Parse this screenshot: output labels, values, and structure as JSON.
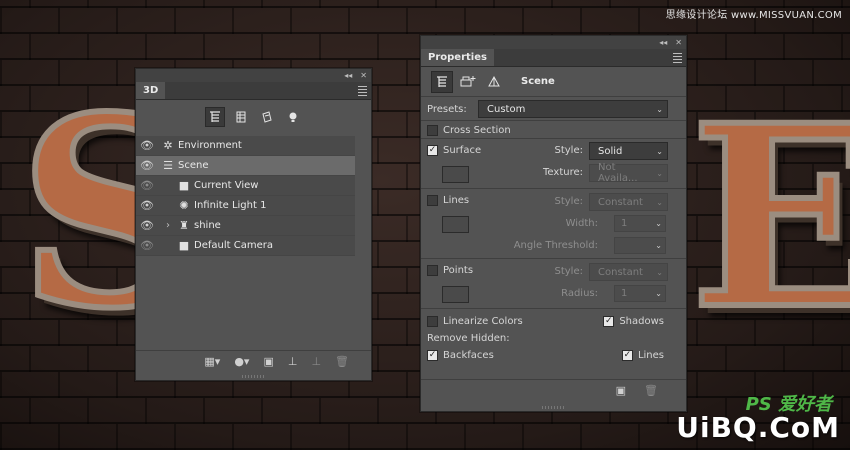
{
  "background": {
    "letter_left": "S",
    "letter_right": "E",
    "watermark_top": "思缘设计论坛 www.MISSVUAN.COM",
    "watermark_ps": "PS 爱好者",
    "watermark_brand": "UiBQ.CoM"
  },
  "panel_3d": {
    "tab": "3D",
    "mode_icons": [
      "scene-filter-icon",
      "mesh-filter-icon",
      "material-filter-icon",
      "light-filter-icon"
    ],
    "layers": [
      {
        "name": "Environment",
        "icon": "environment-icon",
        "visible": true,
        "indent": 0,
        "selected": false
      },
      {
        "name": "Scene",
        "icon": "scene-icon",
        "visible": true,
        "indent": 0,
        "selected": true
      },
      {
        "name": "Current View",
        "icon": "camera-icon",
        "visible": true,
        "indent": 1,
        "selected": false
      },
      {
        "name": "Infinite Light 1",
        "icon": "light-icon",
        "visible": true,
        "indent": 1,
        "selected": false
      },
      {
        "name": "shine",
        "icon": "mesh-icon",
        "visible": true,
        "indent": 1,
        "selected": false
      },
      {
        "name": "Default Camera",
        "icon": "camera-icon",
        "visible": true,
        "indent": 1,
        "selected": false
      }
    ]
  },
  "properties": {
    "tab": "Properties",
    "title": "Scene",
    "presets_label": "Presets:",
    "presets_value": "Custom",
    "cross_section": {
      "label": "Cross Section",
      "checked": false
    },
    "surface": {
      "label": "Surface",
      "checked": true,
      "style_label": "Style:",
      "style_value": "Solid",
      "texture_label": "Texture:",
      "texture_value": "Not Availa..."
    },
    "lines": {
      "label": "Lines",
      "checked": false,
      "style_label": "Style:",
      "style_value": "Constant",
      "width_label": "Width:",
      "width_value": "1",
      "angle_label": "Angle Threshold:",
      "angle_value": ""
    },
    "points": {
      "label": "Points",
      "checked": false,
      "style_label": "Style:",
      "style_value": "Constant",
      "radius_label": "Radius:",
      "radius_value": "1"
    },
    "linearize": {
      "label": "Linearize Colors",
      "checked": false
    },
    "shadows": {
      "label": "Shadows",
      "checked": true
    },
    "remove_hidden_label": "Remove Hidden:",
    "backfaces": {
      "label": "Backfaces",
      "checked": true
    },
    "hidden_lines": {
      "label": "Lines",
      "checked": true
    }
  }
}
